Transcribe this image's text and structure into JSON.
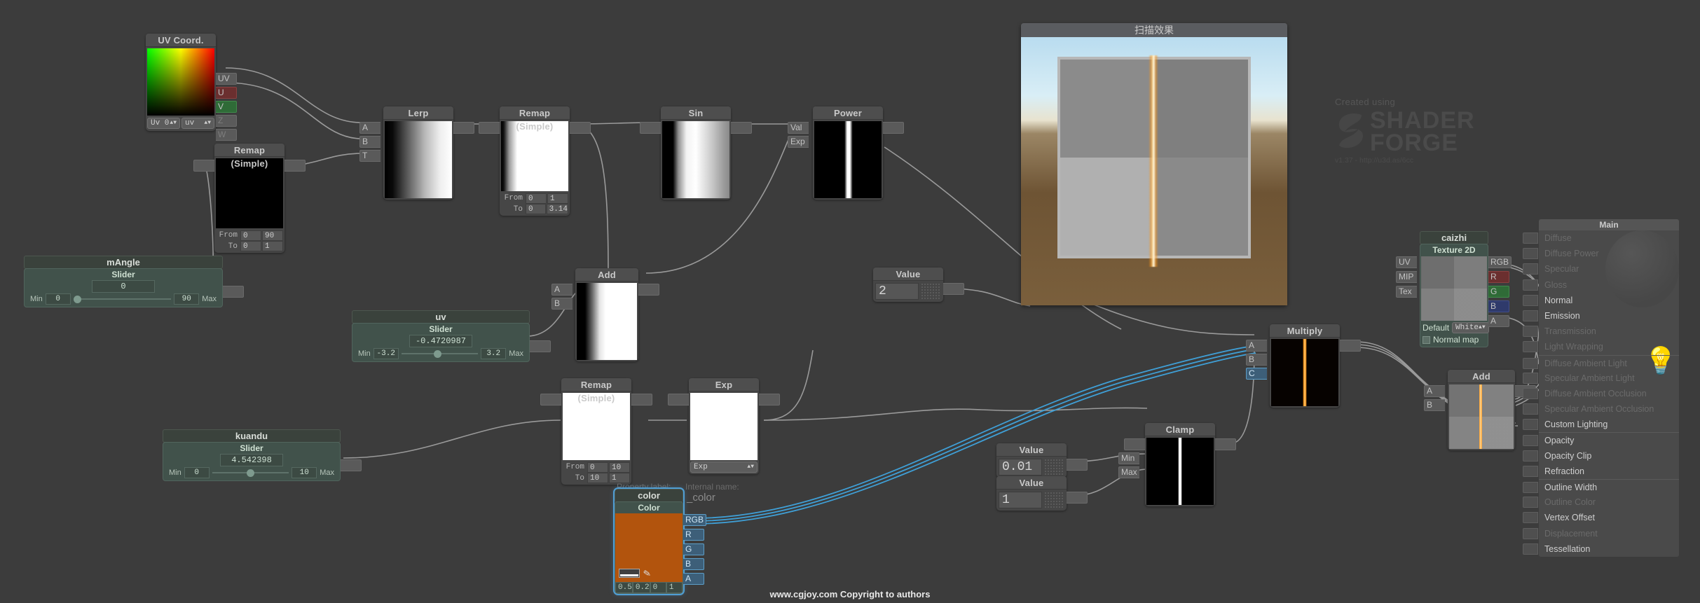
{
  "app": {
    "background": "#3c3c3c",
    "watermark": "www.cgjoy.com Copyright to authors",
    "logo": {
      "created_using": "Created using",
      "line1": "SHADER",
      "line2": "FORGE",
      "version": "v1.37 - http://u3d.as/6cc"
    }
  },
  "preview_window": {
    "title": "扫描效果"
  },
  "property_overlay": {
    "property_label_text": "Property label:",
    "internal_name_text": "Internal name:",
    "internal_name_value": "_color"
  },
  "nodes": {
    "uv_coord": {
      "title": "UV Coord.",
      "outputs": [
        "UV",
        "U",
        "V",
        "Z",
        "W"
      ],
      "dropdown_left": "Uv 0",
      "dropdown_right": "uv"
    },
    "remap_angle": {
      "title": "Remap (Simple)",
      "from_label": "From",
      "from_a": "0",
      "from_b": "90",
      "to_label": "To",
      "to_a": "0",
      "to_b": "1"
    },
    "mangle": {
      "name": "mAngle",
      "sub": "Slider",
      "value": "0",
      "min_label": "Min",
      "min": "0",
      "max": "90",
      "max_label": "Max",
      "knob_pct": 0
    },
    "uv_slider": {
      "name": "uv",
      "sub": "Slider",
      "value": "-0.4720987",
      "min_label": "Min",
      "min": "-3.2",
      "max": "3.2",
      "max_label": "Max",
      "knob_pct": 42.6
    },
    "kuandu": {
      "name": "kuandu",
      "sub": "Slider",
      "value": "4.542398",
      "min_label": "Min",
      "min": "0",
      "max": "10",
      "max_label": "Max",
      "knob_pct": 45.4
    },
    "lerp": {
      "title": "Lerp",
      "inputs": [
        "A",
        "B",
        "T"
      ]
    },
    "remap_pi": {
      "title": "Remap (Simple)",
      "from_label": "From",
      "from_a": "0",
      "from_b": "1",
      "to_label": "To",
      "to_a": "0",
      "to_b": "3.14"
    },
    "sin": {
      "title": "Sin"
    },
    "power": {
      "title": "Power",
      "inputs": [
        "Val",
        "Exp"
      ]
    },
    "add_mid": {
      "title": "Add",
      "inputs": [
        "A",
        "B"
      ]
    },
    "value_2": {
      "title": "Value",
      "value": "2"
    },
    "remap_width": {
      "title": "Remap (Simple)",
      "from_label": "From",
      "from_a": "0",
      "from_b": "10",
      "to_label": "To",
      "to_a": "10",
      "to_b": "1"
    },
    "exp": {
      "title": "Exp",
      "dropdown": "Exp"
    },
    "color": {
      "name": "color",
      "sub": "Color",
      "swatch_hex": "#b2540d",
      "channels": [
        "RGB",
        "R",
        "G",
        "B",
        "A"
      ],
      "values": [
        "0.5",
        "0.2",
        "0",
        "1"
      ]
    },
    "value_001": {
      "title": "Value",
      "value": "0.01"
    },
    "value_1": {
      "title": "Value",
      "value": "1"
    },
    "clamp": {
      "title": "Clamp",
      "inputs": [
        "Min",
        "Max"
      ]
    },
    "multiply": {
      "title": "Multiply",
      "inputs": [
        "A",
        "B",
        "C"
      ]
    },
    "caizhi": {
      "name": "caizhi",
      "sub": "Texture 2D",
      "inputs": [
        "UV",
        "MIP",
        "Tex"
      ],
      "outputs": [
        "RGB",
        "R",
        "G",
        "B",
        "A"
      ],
      "default_label": "Default",
      "default_value": "White",
      "normal_map_label": "Normal map"
    },
    "add_right": {
      "title": "Add",
      "inputs": [
        "A",
        "B"
      ]
    }
  },
  "main_node": {
    "title": "Main",
    "rows": [
      {
        "label": "Diffuse",
        "enabled": false,
        "socket": true
      },
      {
        "label": "Diffuse Power",
        "enabled": false,
        "socket": true
      },
      {
        "label": "Specular",
        "enabled": false,
        "socket": true
      },
      {
        "label": "Gloss",
        "enabled": false,
        "socket": true
      },
      {
        "label": "Normal",
        "enabled": true,
        "socket": true
      },
      {
        "label": "Emission",
        "enabled": true,
        "socket": true
      },
      {
        "label": "Transmission",
        "enabled": false,
        "socket": true
      },
      {
        "label": "Light Wrapping",
        "enabled": false,
        "socket": true
      },
      {
        "label": "Diffuse Ambient Light",
        "enabled": false,
        "socket": true
      },
      {
        "label": "Specular Ambient Light",
        "enabled": false,
        "socket": true
      },
      {
        "label": "Diffuse Ambient Occlusion",
        "enabled": false,
        "socket": true
      },
      {
        "label": "Specular Ambient Occlusion",
        "enabled": false,
        "socket": true
      },
      {
        "label": "Custom Lighting",
        "enabled": true,
        "socket": true
      },
      {
        "label": "Opacity",
        "enabled": true,
        "socket": true
      },
      {
        "label": "Opacity Clip",
        "enabled": true,
        "socket": true
      },
      {
        "label": "Refraction",
        "enabled": true,
        "socket": true
      },
      {
        "label": "Outline Width",
        "enabled": true,
        "socket": true
      },
      {
        "label": "Outline Color",
        "enabled": false,
        "socket": true
      },
      {
        "label": "Vertex Offset",
        "enabled": true,
        "socket": true
      },
      {
        "label": "Displacement",
        "enabled": false,
        "socket": true
      },
      {
        "label": "Tessellation",
        "enabled": true,
        "socket": true
      }
    ]
  },
  "colors": {
    "wire": "#9a9a9a",
    "wire_selected": "#3f9fd6",
    "accent_orange": "#ff9a1e",
    "node_bg": "#464646",
    "node_header": "#4e4e4e",
    "prop_bg": "#41524b"
  }
}
